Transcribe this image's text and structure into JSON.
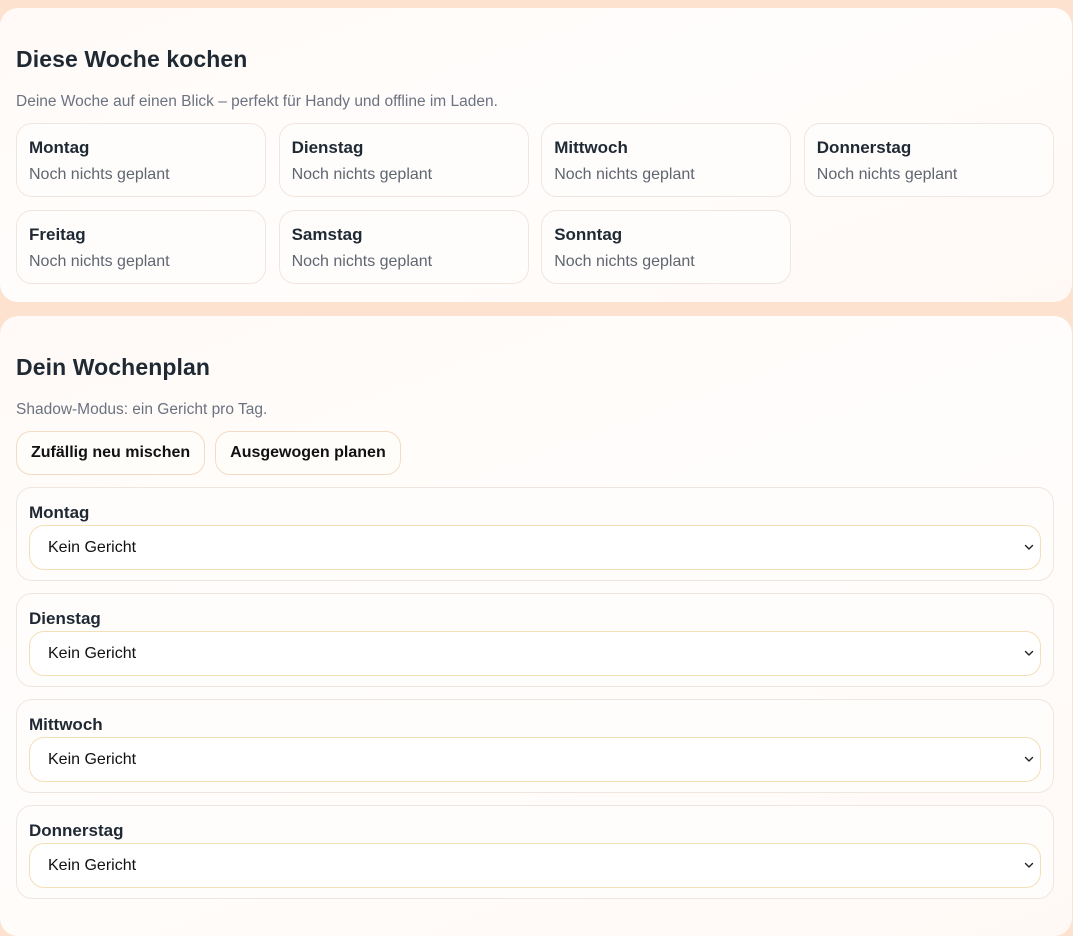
{
  "week_overview": {
    "title": "Diese Woche kochen",
    "subtitle": "Deine Woche auf einen Blick – perfekt für Handy und offline im Laden.",
    "days": [
      {
        "name": "Montag",
        "status": "Noch nichts geplant"
      },
      {
        "name": "Dienstag",
        "status": "Noch nichts geplant"
      },
      {
        "name": "Mittwoch",
        "status": "Noch nichts geplant"
      },
      {
        "name": "Donnerstag",
        "status": "Noch nichts geplant"
      },
      {
        "name": "Freitag",
        "status": "Noch nichts geplant"
      },
      {
        "name": "Samstag",
        "status": "Noch nichts geplant"
      },
      {
        "name": "Sonntag",
        "status": "Noch nichts geplant"
      }
    ]
  },
  "week_plan": {
    "title": "Dein Wochenplan",
    "subtitle": "Shadow-Modus: ein Gericht pro Tag.",
    "buttons": {
      "shuffle_label": "Zufällig neu mischen",
      "balanced_label": "Ausgewogen planen"
    },
    "rows": [
      {
        "day": "Montag",
        "selected": "Kein Gericht"
      },
      {
        "day": "Dienstag",
        "selected": "Kein Gericht"
      },
      {
        "day": "Mittwoch",
        "selected": "Kein Gericht"
      },
      {
        "day": "Donnerstag",
        "selected": "Kein Gericht"
      }
    ]
  },
  "icons": {
    "select_arrow": "chevron-down-icon"
  },
  "colors": {
    "page_background": "#fde3cf",
    "card_background": "#fffdfc",
    "heading_text": "#1f2933",
    "muted_text": "#6b7280",
    "button_border": "#f2dcc4",
    "select_border": "#f3dfb8"
  }
}
